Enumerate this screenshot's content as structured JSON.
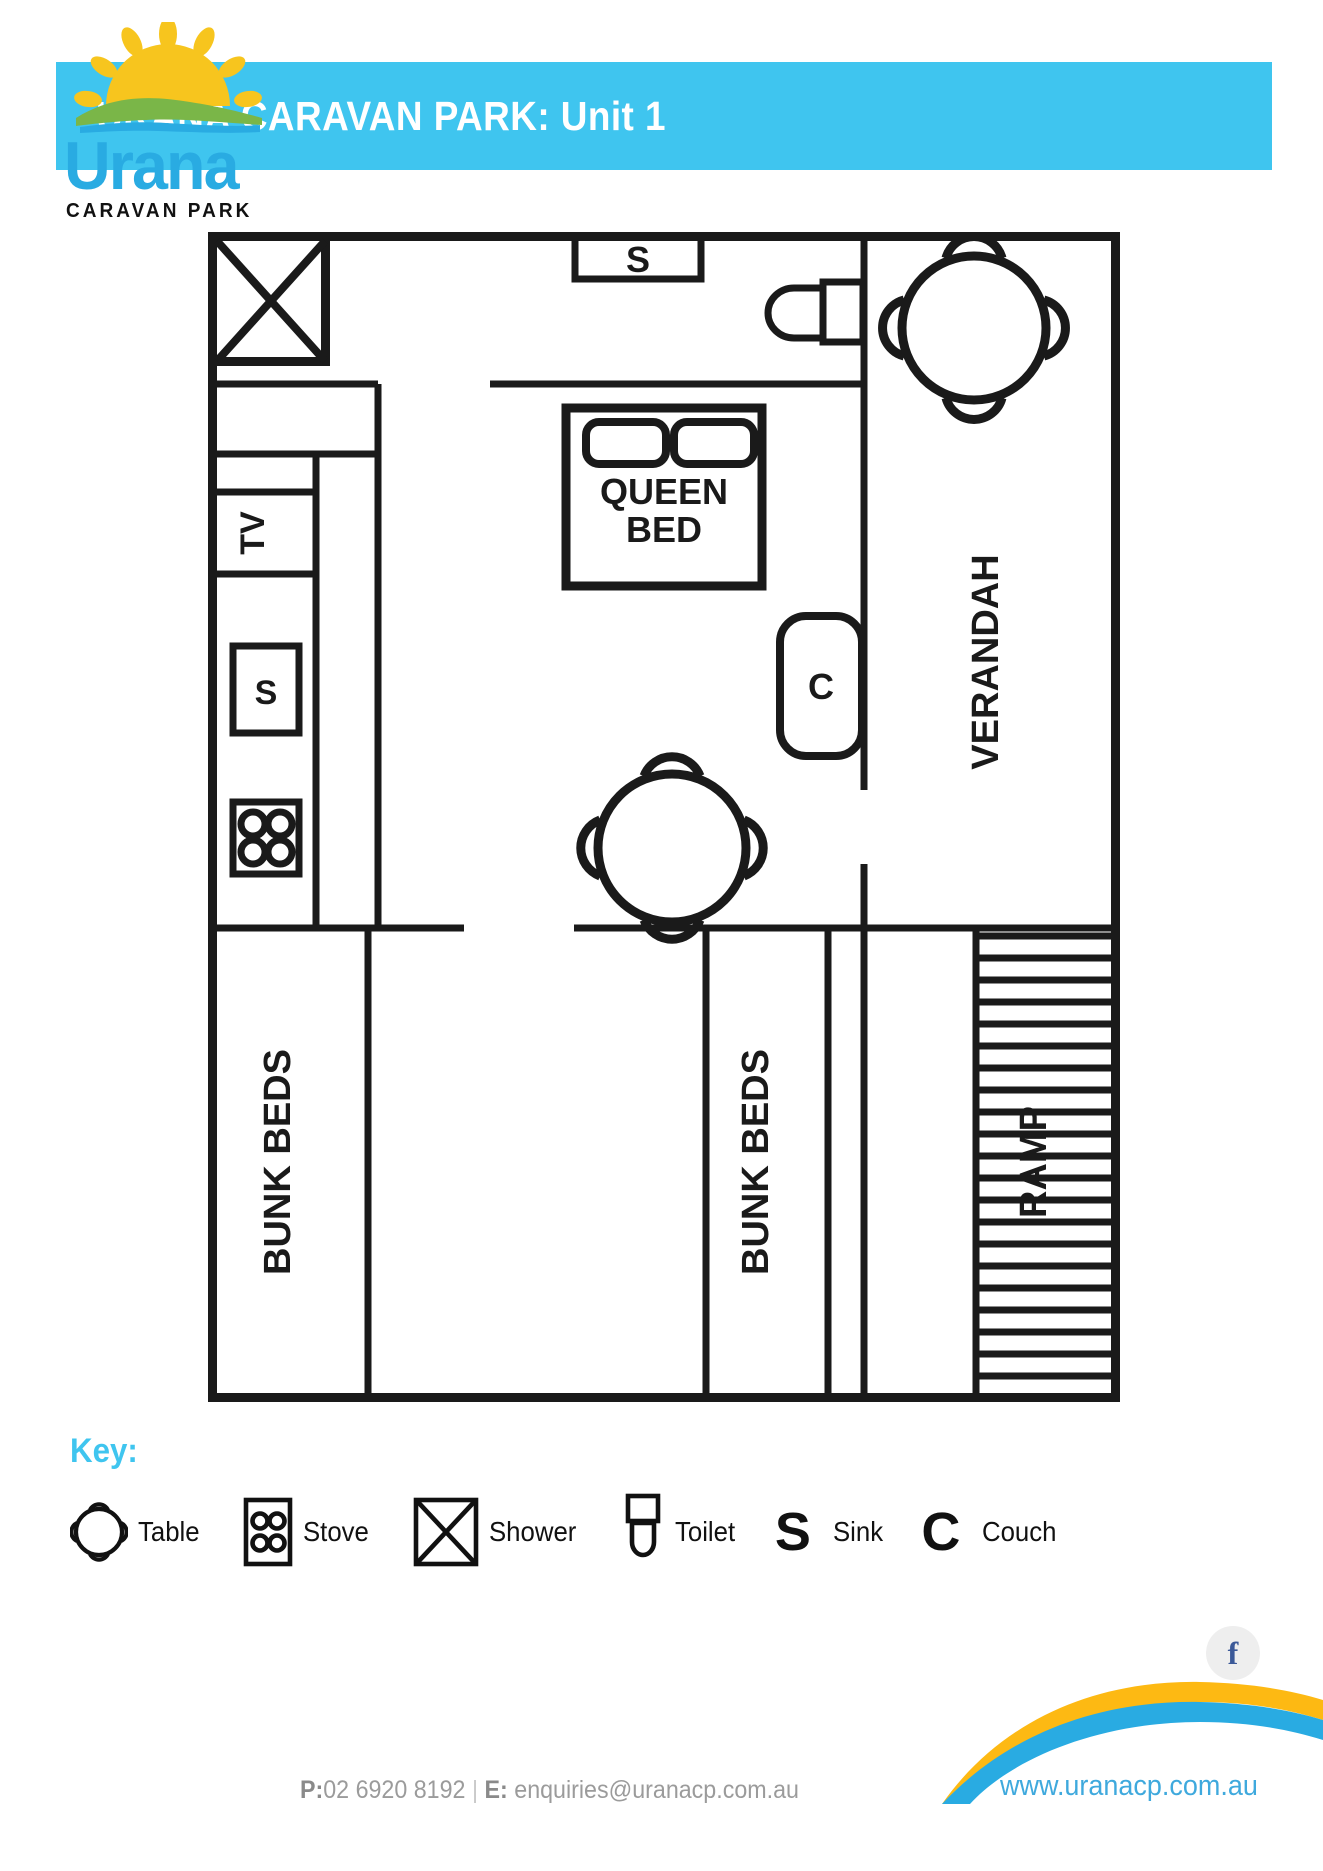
{
  "header": {
    "title": "URANA CARAVAN PARK: Unit 1",
    "bg_color": "#3fc5ef",
    "text_color": "#ffffff"
  },
  "floorplan": {
    "rooms": {
      "verandah": "VERANDAH",
      "ramp": "RAMP",
      "bunk_beds_left": "BUNK BEDS",
      "bunk_beds_right": "BUNK BEDS"
    },
    "furniture": {
      "queen_bed_line1": "QUEEN",
      "queen_bed_line2": "BED",
      "tv": "TV",
      "sink_bathroom": "S",
      "sink_kitchen": "S",
      "couch": "C"
    },
    "stroke_color": "#1a1a1a"
  },
  "key": {
    "heading": "Key:",
    "heading_color": "#3fc5ef",
    "items": [
      {
        "icon": "table-icon",
        "label": "Table"
      },
      {
        "icon": "stove-icon",
        "label": "Stove"
      },
      {
        "icon": "shower-icon",
        "label": "Shower"
      },
      {
        "icon": "toilet-icon",
        "label": "Toilet"
      },
      {
        "icon": "sink-icon",
        "label": "Sink",
        "glyph": "S"
      },
      {
        "icon": "couch-icon",
        "label": "Couch",
        "glyph": "C"
      }
    ]
  },
  "footer": {
    "logo_wordmark": "Urana",
    "logo_subtitle": "CARAVAN PARK",
    "phone_prefix": "P:",
    "phone": "02 6920 8192",
    "separator": "|",
    "email_prefix": "E:",
    "email": "enquiries@uranacp.com.au",
    "website": "www.uranacp.com.au",
    "social": "facebook-icon",
    "social_glyph": "f",
    "colors": {
      "brand_blue": "#29abe2",
      "sun_yellow": "#f7c51e",
      "hill_green": "#7ab648",
      "swoosh_yellow": "#fdb913",
      "swoosh_blue": "#29abe2",
      "facebook_blue": "#3b5998",
      "contact_grey": "#9b9b9b"
    }
  }
}
